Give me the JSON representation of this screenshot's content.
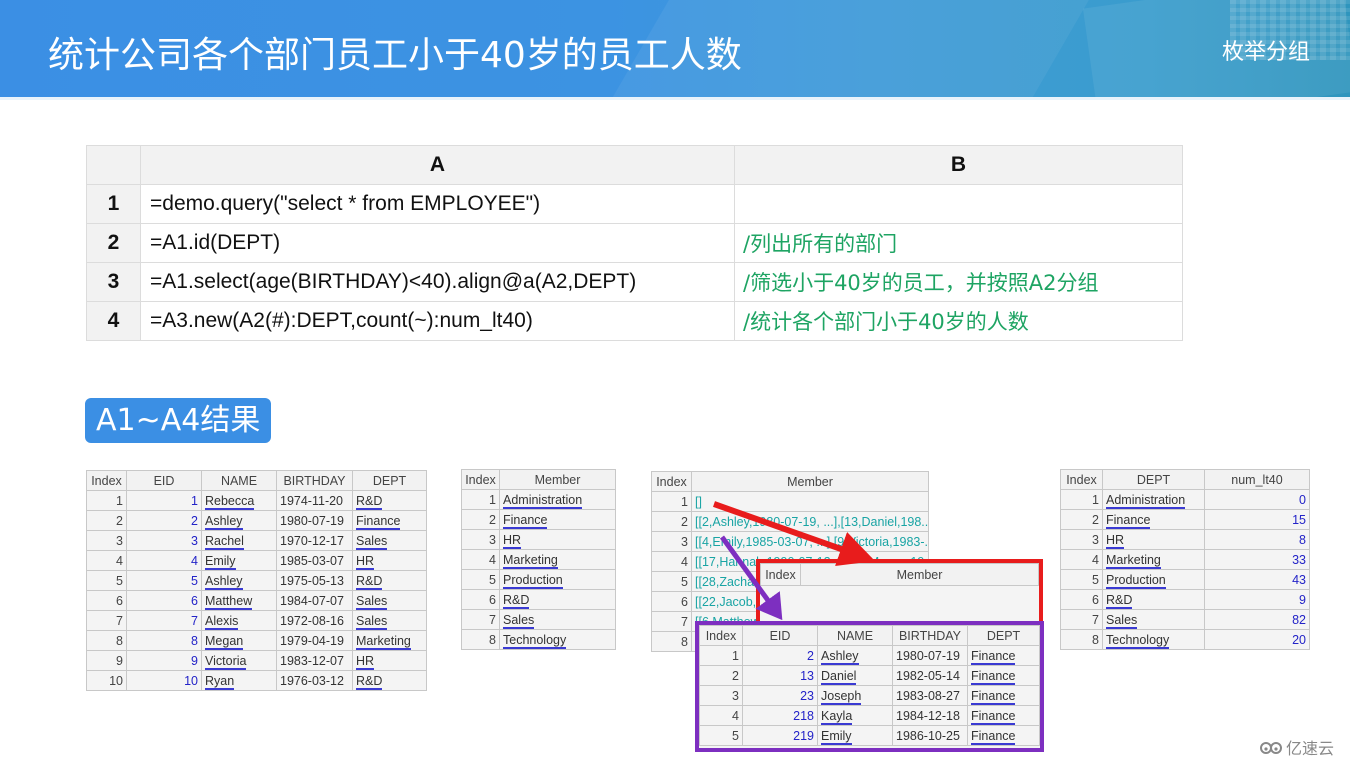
{
  "header": {
    "title": "统计公司各个部门员工小于40岁的员工人数",
    "subtitle": "枚举分组"
  },
  "code_grid": {
    "columns": [
      "A",
      "B"
    ],
    "rows": [
      {
        "num": "1",
        "a": "=demo.query(\"select * from   EMPLOYEE\")",
        "b": ""
      },
      {
        "num": "2",
        "a": "=A1.id(DEPT)",
        "b": "/列出所有的部门"
      },
      {
        "num": "3",
        "a": "=A1.select(age(BIRTHDAY)<40).align@a(A2,DEPT)",
        "b": "/筛选小于40岁的员工，并按照A2分组"
      },
      {
        "num": "4",
        "a": "=A3.new(A2(#):DEPT,count(~):num_lt40)",
        "b": "/统计各个部门小于40岁的人数"
      }
    ]
  },
  "section_label": "A1~A4结果",
  "a1_table": {
    "headers": [
      "Index",
      "EID",
      "NAME",
      "BIRTHDAY",
      "DEPT"
    ],
    "rows": [
      [
        "1",
        "1",
        "Rebecca",
        "1974-11-20",
        "R&D"
      ],
      [
        "2",
        "2",
        "Ashley",
        "1980-07-19",
        "Finance"
      ],
      [
        "3",
        "3",
        "Rachel",
        "1970-12-17",
        "Sales"
      ],
      [
        "4",
        "4",
        "Emily",
        "1985-03-07",
        "HR"
      ],
      [
        "5",
        "5",
        "Ashley",
        "1975-05-13",
        "R&D"
      ],
      [
        "6",
        "6",
        "Matthew",
        "1984-07-07",
        "Sales"
      ],
      [
        "7",
        "7",
        "Alexis",
        "1972-08-16",
        "Sales"
      ],
      [
        "8",
        "8",
        "Megan",
        "1979-04-19",
        "Marketing"
      ],
      [
        "9",
        "9",
        "Victoria",
        "1983-12-07",
        "HR"
      ],
      [
        "10",
        "10",
        "Ryan",
        "1976-03-12",
        "R&D"
      ]
    ]
  },
  "a2_table": {
    "headers": [
      "Index",
      "Member"
    ],
    "rows": [
      [
        "1",
        "Administration"
      ],
      [
        "2",
        "Finance"
      ],
      [
        "3",
        "HR"
      ],
      [
        "4",
        "Marketing"
      ],
      [
        "5",
        "Production"
      ],
      [
        "6",
        "R&D"
      ],
      [
        "7",
        "Sales"
      ],
      [
        "8",
        "Technology"
      ]
    ]
  },
  "a3_table": {
    "headers": [
      "Index",
      "Member"
    ],
    "rows": [
      [
        "1",
        "[]"
      ],
      [
        "2",
        "[[2,Ashley,1980-07-19, ...],[13,Daniel,198..."
      ],
      [
        "3",
        "[[4,Emily,1985-03-07, ...],[9,Victoria,1983-..."
      ],
      [
        "4",
        "[[17,Hannah,1990-07-12, ...],[8,Megan,19..."
      ],
      [
        "5",
        "[[28,Zachary,..."
      ],
      [
        "6",
        "[[22,Jacob,..."
      ],
      [
        "7",
        "[[6,Matthew,..."
      ],
      [
        "8",
        ""
      ]
    ]
  },
  "a3_empty_popup": {
    "headers": [
      "Index",
      "Member"
    ]
  },
  "a3_finance_popup": {
    "headers": [
      "Index",
      "EID",
      "NAME",
      "BIRTHDAY",
      "DEPT"
    ],
    "rows": [
      [
        "1",
        "2",
        "Ashley",
        "1980-07-19",
        "Finance"
      ],
      [
        "2",
        "13",
        "Daniel",
        "1982-05-14",
        "Finance"
      ],
      [
        "3",
        "23",
        "Joseph",
        "1983-08-27",
        "Finance"
      ],
      [
        "4",
        "218",
        "Kayla",
        "1984-12-18",
        "Finance"
      ],
      [
        "5",
        "219",
        "Emily",
        "1986-10-25",
        "Finance"
      ]
    ]
  },
  "a4_table": {
    "headers": [
      "Index",
      "DEPT",
      "num_lt40"
    ],
    "rows": [
      [
        "1",
        "Administration",
        "0"
      ],
      [
        "2",
        "Finance",
        "15"
      ],
      [
        "3",
        "HR",
        "8"
      ],
      [
        "4",
        "Marketing",
        "33"
      ],
      [
        "5",
        "Production",
        "43"
      ],
      [
        "6",
        "R&D",
        "9"
      ],
      [
        "7",
        "Sales",
        "82"
      ],
      [
        "8",
        "Technology",
        "20"
      ]
    ]
  },
  "colors": {
    "banner_blue": "#3b8fe4",
    "comment_green": "#1ea463",
    "arrow_red": "#e81c1c",
    "arrow_purple": "#7d2fc0",
    "number_blue": "#2323c8",
    "teal_text": "#19a4a4"
  },
  "logo": {
    "icon": "cloud-logo-icon",
    "text": "亿速云"
  }
}
